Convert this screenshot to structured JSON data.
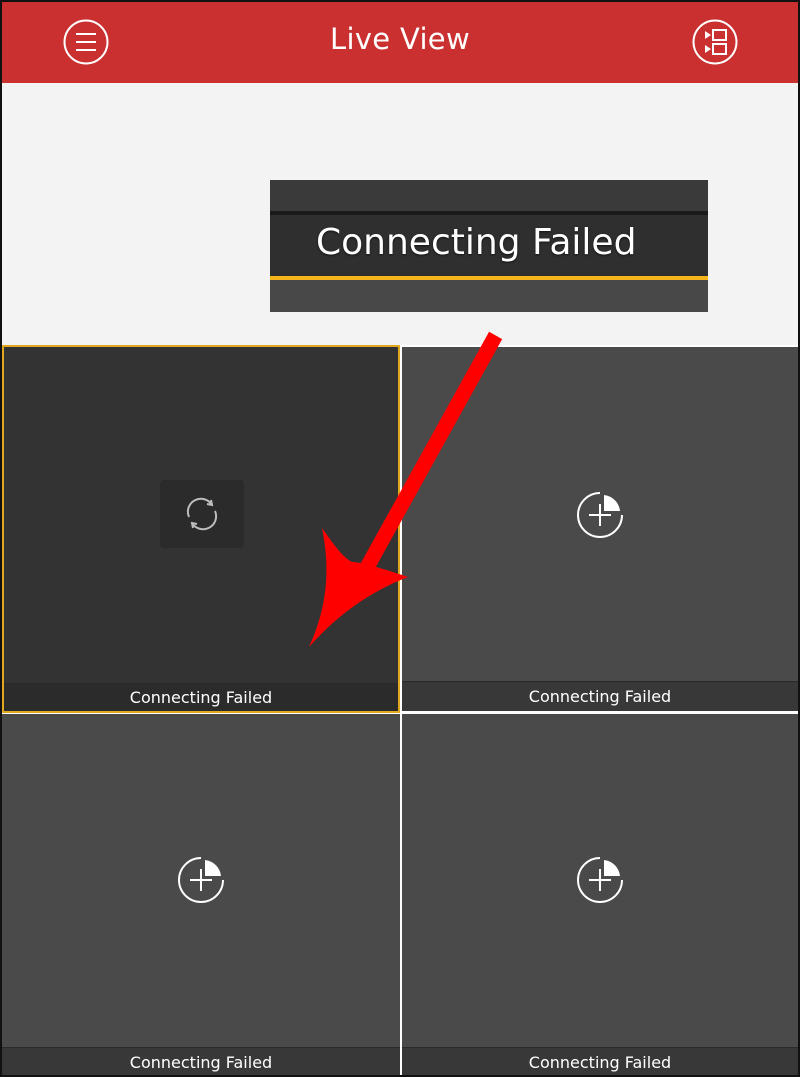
{
  "header": {
    "title": "Live View",
    "bg_color": "#c9302f",
    "menu_icon": "hamburger-menu-icon",
    "layout_icon": "window-layout-icon"
  },
  "callout": {
    "text": "Connecting Failed",
    "accent_color": "#f3b51a"
  },
  "grid": {
    "cells": [
      {
        "label": "Connecting Failed",
        "state": "selected",
        "icon": "refresh-icon"
      },
      {
        "label": "Connecting Failed",
        "state": "empty",
        "icon": "add-camera-icon"
      },
      {
        "label": "Connecting Failed",
        "state": "empty",
        "icon": "add-camera-icon"
      },
      {
        "label": "Connecting Failed",
        "state": "empty",
        "icon": "add-camera-icon"
      }
    ],
    "selected_border_color": "#e0a81f"
  },
  "annotation": {
    "icon": "red-arrow-icon",
    "color": "#ff0000"
  }
}
